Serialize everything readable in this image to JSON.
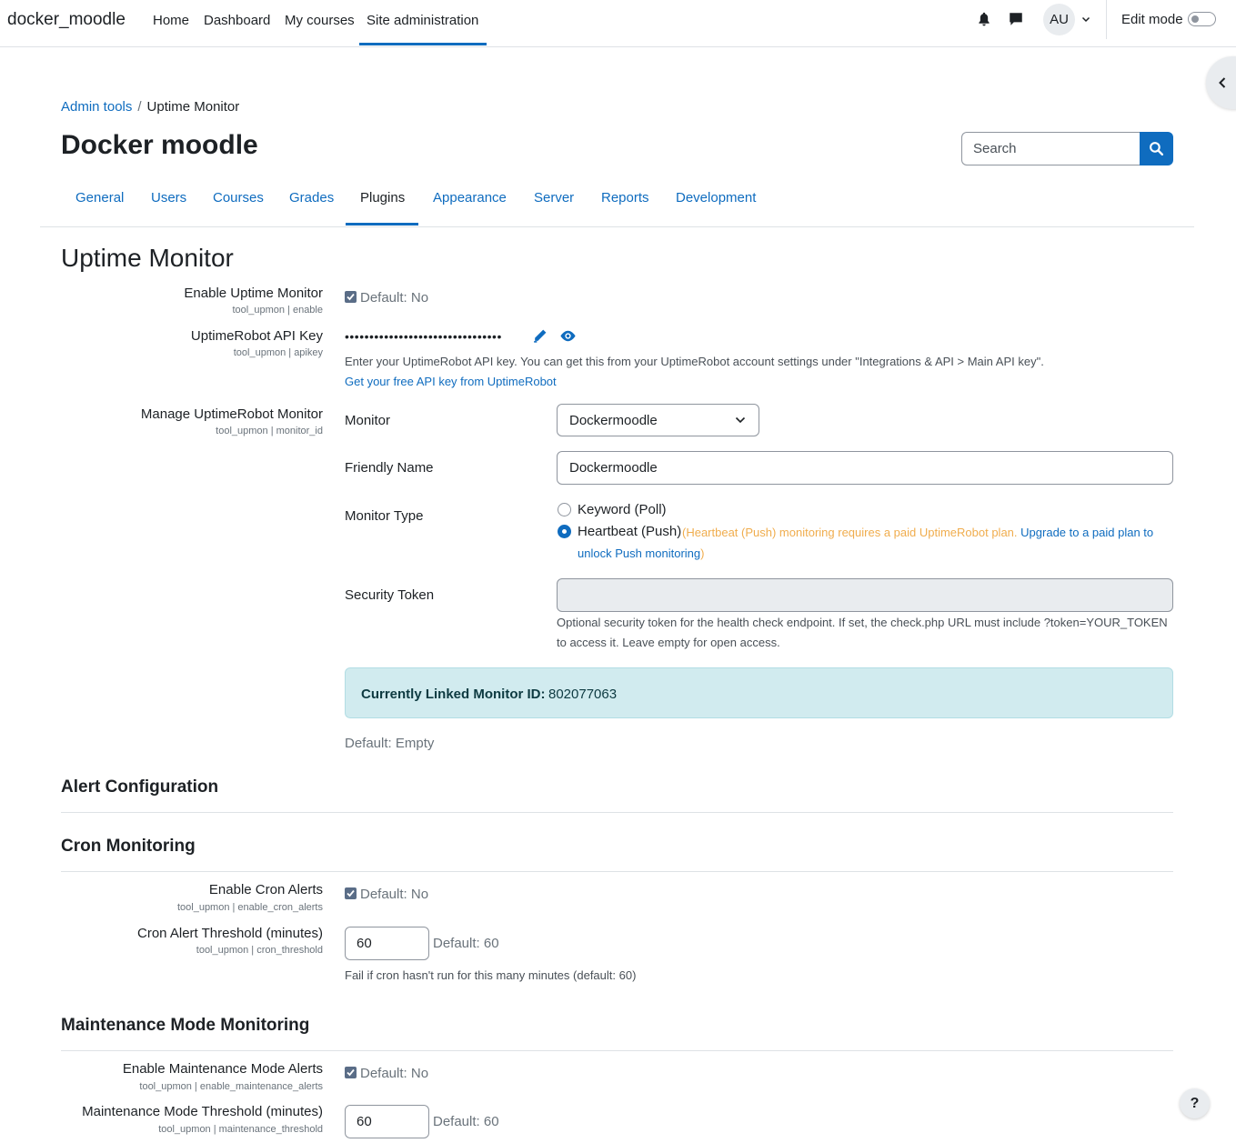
{
  "topnav": {
    "brand": "docker_moodle",
    "links": [
      "Home",
      "Dashboard",
      "My courses",
      "Site administration"
    ],
    "active_link": "Site administration",
    "avatar": "AU",
    "edit_mode_label": "Edit mode",
    "icons": [
      "bell-icon",
      "chat-icon",
      "chevron-down-icon"
    ]
  },
  "breadcrumb": {
    "items": [
      "Admin tools",
      "Uptime Monitor"
    ]
  },
  "page_title": "Docker moodle",
  "search": {
    "placeholder": "Search"
  },
  "tabs": {
    "items": [
      "General",
      "Users",
      "Courses",
      "Grades",
      "Plugins",
      "Appearance",
      "Server",
      "Reports",
      "Development"
    ],
    "active": "Plugins"
  },
  "section_title": "Uptime Monitor",
  "settings": {
    "enable": {
      "label": "Enable Uptime Monitor",
      "key": "tool_upmon | enable",
      "checked": true,
      "default": "Default: No"
    },
    "apikey": {
      "label": "UptimeRobot API Key",
      "key": "tool_upmon | apikey",
      "masked_value": "••••••••••••••••••••••••••••••••",
      "help": "Enter your UptimeRobot API key. You can get this from your UptimeRobot account settings under \"Integrations & API > Main API key\".",
      "link": "Get your free API key from UptimeRobot"
    },
    "manage": {
      "label": "Manage UptimeRobot Monitor",
      "key": "tool_upmon | monitor_id",
      "monitor_label": "Monitor",
      "monitor_value": "Dockermoodle",
      "friendly_label": "Friendly Name",
      "friendly_value": "Dockermoodle",
      "type_label": "Monitor Type",
      "type_options": [
        "Keyword (Poll)",
        "Heartbeat (Push)"
      ],
      "type_selected": "Heartbeat (Push)",
      "push_warning_prefix": "(Heartbeat (Push) monitoring requires a paid UptimeRobot plan.",
      "push_warning_link_1": "Upgrade to a paid plan to",
      "push_warning_link_2": "unlock Push monitoring",
      "push_warning_suffix": ")",
      "token_label": "Security Token",
      "token_value": "",
      "token_help_1": "Optional security token for the health check endpoint. If set, the check.php URL must include ?token=YOUR_TOKEN",
      "token_help_2": "to access it. Leave empty for open access.",
      "linked_label": "Currently Linked Monitor ID:",
      "linked_value": "802077063",
      "default": "Default: Empty"
    }
  },
  "alert_config_title": "Alert Configuration",
  "cron": {
    "title": "Cron Monitoring",
    "enable_label": "Enable Cron Alerts",
    "enable_key": "tool_upmon | enable_cron_alerts",
    "enable_checked": true,
    "enable_default": "Default: No",
    "threshold_label": "Cron Alert Threshold (minutes)",
    "threshold_key": "tool_upmon | cron_threshold",
    "threshold_value": "60",
    "threshold_default": "Default: 60",
    "threshold_help": "Fail if cron hasn't run for this many minutes (default: 60)"
  },
  "maintenance": {
    "title": "Maintenance Mode Monitoring",
    "enable_label": "Enable Maintenance Mode Alerts",
    "enable_key": "tool_upmon | enable_maintenance_alerts",
    "enable_checked": true,
    "enable_default": "Default: No",
    "threshold_label": "Maintenance Mode Threshold (minutes)",
    "threshold_key": "tool_upmon | maintenance_threshold",
    "threshold_value": "60",
    "threshold_default": "Default: 60"
  },
  "help_button": "?"
}
